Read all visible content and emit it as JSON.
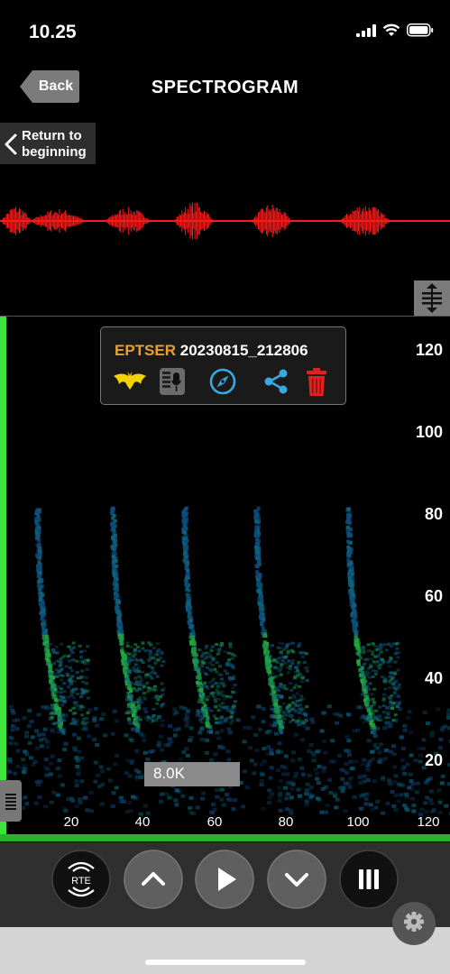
{
  "status_bar": {
    "time": "10.25",
    "icons": [
      "signal-icon",
      "wifi-icon",
      "battery-icon"
    ]
  },
  "nav": {
    "back_label": "Back",
    "title": "SPECTROGRAM"
  },
  "return_button": {
    "line1": "Return to",
    "line2": "beginning"
  },
  "recording": {
    "species": "EPTSER",
    "name": "20230815_212806"
  },
  "card_icons": [
    "bat-icon",
    "recorder-icon",
    "compass-icon",
    "share-icon",
    "trash-icon"
  ],
  "spectrogram": {
    "y_ticks": [
      "120",
      "100",
      "80",
      "60",
      "40",
      "20"
    ],
    "x_ticks": [
      "20",
      "40",
      "60",
      "80",
      "100",
      "120"
    ],
    "level_label": "8.0K"
  },
  "controls": {
    "rte_label": "RTE"
  },
  "colors": {
    "waveform": "#ff1a1a",
    "species_accent": "#eaa02a",
    "frequency_bar": "#3ce43c",
    "icon_blue": "#3aa8e0",
    "trash_red": "#e22222",
    "bat_yellow": "#f2d200"
  }
}
